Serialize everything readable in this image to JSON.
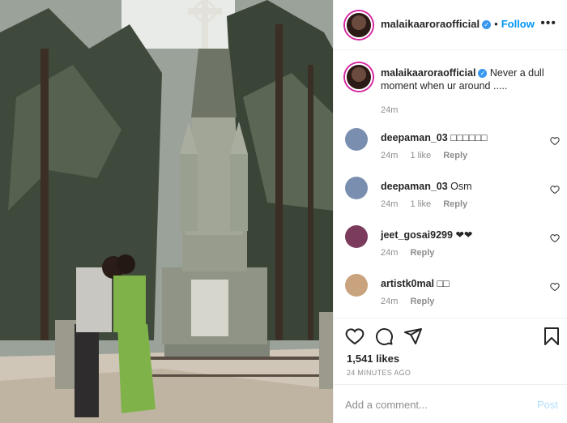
{
  "post": {
    "username": "malaikaaroraofficial",
    "follow_label": "Follow",
    "dot": "•",
    "more_label": "•••",
    "verified_mark": "✓",
    "caption_text": "Never a dull moment when ur around .....",
    "caption_time": "24m",
    "likes": "1,541 likes",
    "time_ago": "24 MINUTES AGO"
  },
  "comments": [
    {
      "user": "deepaman_03",
      "text": "□□□□□□",
      "time": "24m",
      "likes": "1 like",
      "reply": "Reply",
      "avatar_color": "#7a8fb0"
    },
    {
      "user": "deepaman_03",
      "text": "Osm",
      "time": "24m",
      "likes": "1 like",
      "reply": "Reply",
      "avatar_color": "#7a8fb0"
    },
    {
      "user": "jeet_gosai9299",
      "text": "❤❤",
      "time": "24m",
      "likes": "",
      "reply": "Reply",
      "avatar_color": "#7a3b5c"
    },
    {
      "user": "artistk0mal",
      "text": "□□",
      "time": "24m",
      "likes": "",
      "reply": "Reply",
      "avatar_color": "#c9a27e"
    }
  ],
  "add_comment": {
    "placeholder": "Add a comment...",
    "post_label": "Post"
  },
  "icons": {
    "like": "heart-icon",
    "comment": "comment-icon",
    "share": "share-icon",
    "save": "bookmark-icon",
    "more": "more-options-icon",
    "verified": "verified-badge-icon"
  },
  "colors": {
    "accent": "#0095f6",
    "verified": "#3897f0",
    "post_disabled": "#b2dffc"
  }
}
